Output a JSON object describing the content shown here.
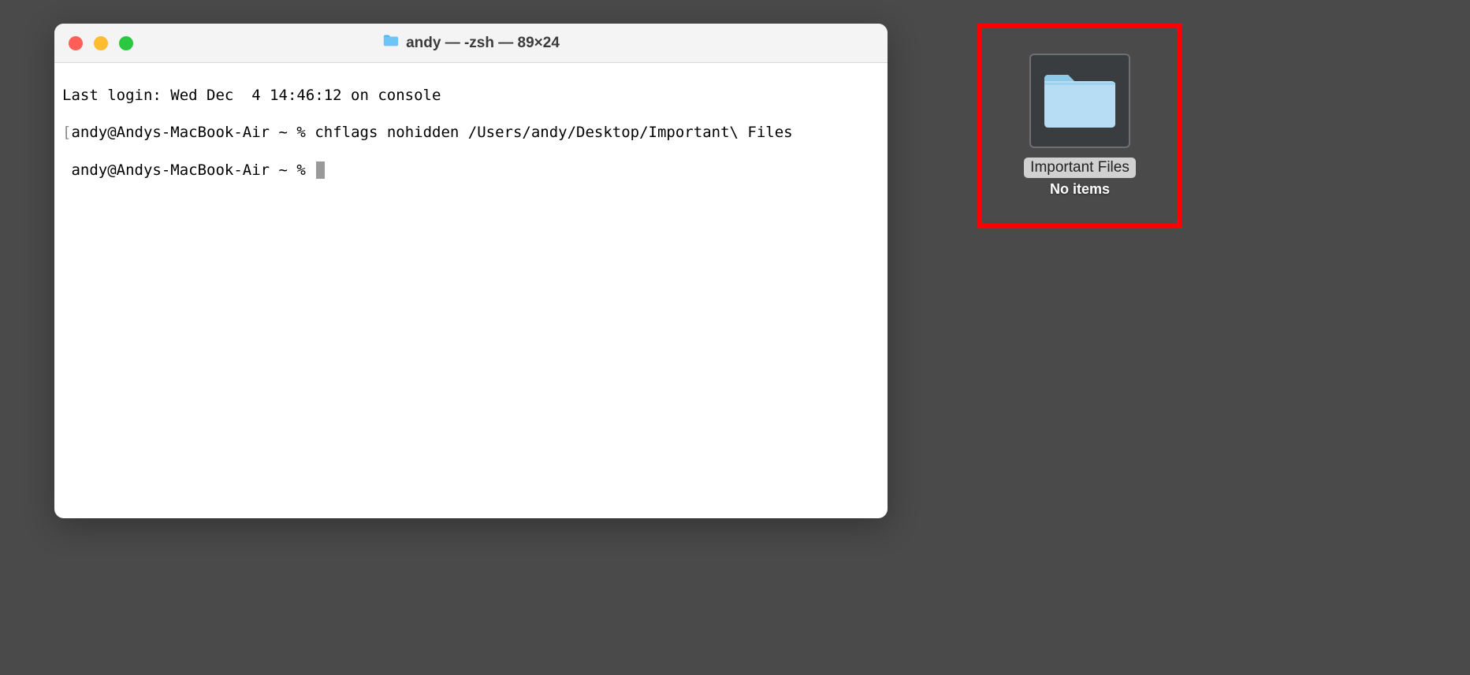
{
  "terminal": {
    "title": "andy — -zsh — 89×24",
    "lines": {
      "line1": "Last login: Wed Dec  4 14:46:12 on console",
      "line2_prefix": "[",
      "line2_prompt": "andy@Andys-MacBook-Air ~ % ",
      "line2_cmd": "chflags nohidden /Users/andy/Desktop/Important\\ Files",
      "line2_suffix_spacer": "                                                                ]",
      "line3_prompt": "andy@Andys-MacBook-Air ~ % "
    }
  },
  "desktop": {
    "folder_name": "Important Files",
    "folder_subtitle": "No items"
  },
  "colors": {
    "highlight": "#ff0000"
  }
}
